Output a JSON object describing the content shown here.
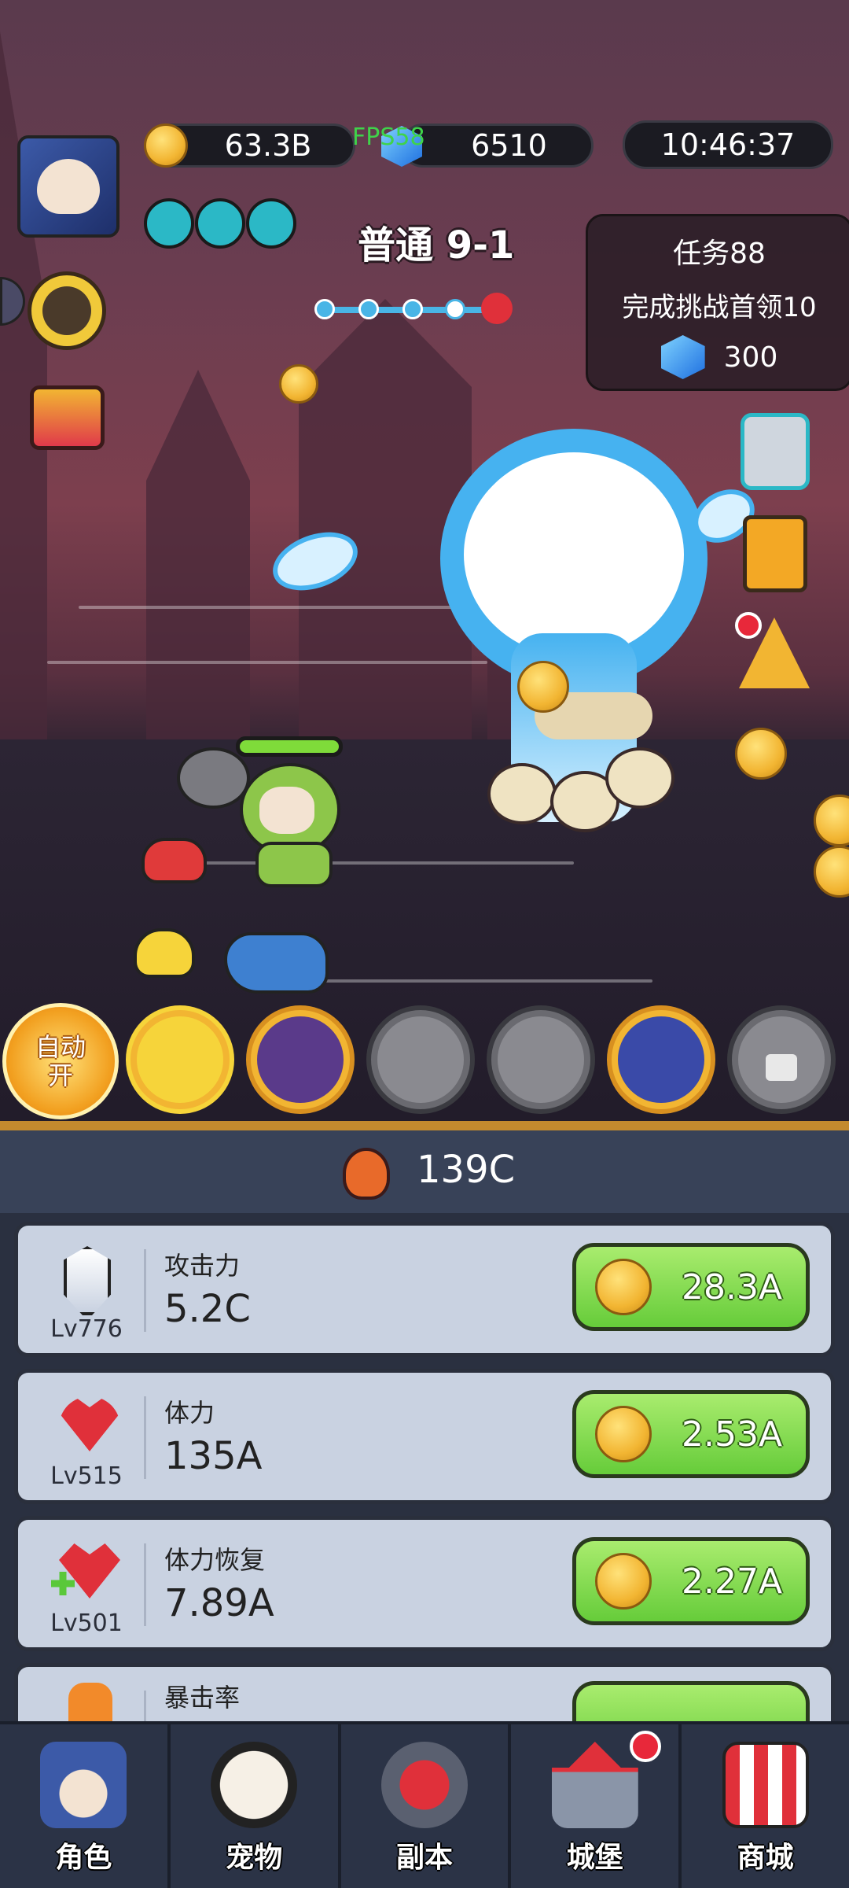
{
  "hud": {
    "gold": "63.3B",
    "gems": "6510",
    "fps": "FPS58",
    "clock": "10:46:37",
    "stage": "普通 9-1"
  },
  "quest": {
    "title": "任务88",
    "desc": "完成挑战首领10",
    "reward": "300"
  },
  "skills": {
    "auto_label": "自动\n开",
    "auto_line1": "自动",
    "auto_line2": "开"
  },
  "total_power": "139C",
  "upgrades": [
    {
      "name": "攻击力",
      "value": "5.2C",
      "level": "Lv776",
      "cost": "28.3A",
      "icon": "sword-icon"
    },
    {
      "name": "体力",
      "value": "135A",
      "level": "Lv515",
      "cost": "2.53A",
      "icon": "heart-icon"
    },
    {
      "name": "体力恢复",
      "value": "7.89A",
      "level": "Lv501",
      "cost": "2.27A",
      "icon": "heart-plus-icon"
    },
    {
      "name": "暴击率",
      "value": "",
      "level": "",
      "cost": "",
      "icon": "claw-icon"
    }
  ],
  "nav": [
    {
      "label": "角色",
      "icon": "hero-icon"
    },
    {
      "label": "宠物",
      "icon": "panda-icon"
    },
    {
      "label": "副本",
      "icon": "crossed-swords-icon"
    },
    {
      "label": "城堡",
      "icon": "castle-icon"
    },
    {
      "label": "商城",
      "icon": "shop-icon"
    }
  ],
  "colors": {
    "accent_gold": "#f2b532",
    "button_green": "#66cc3a",
    "panel_bg": "#2a3040",
    "badge_red": "#e8283a"
  }
}
